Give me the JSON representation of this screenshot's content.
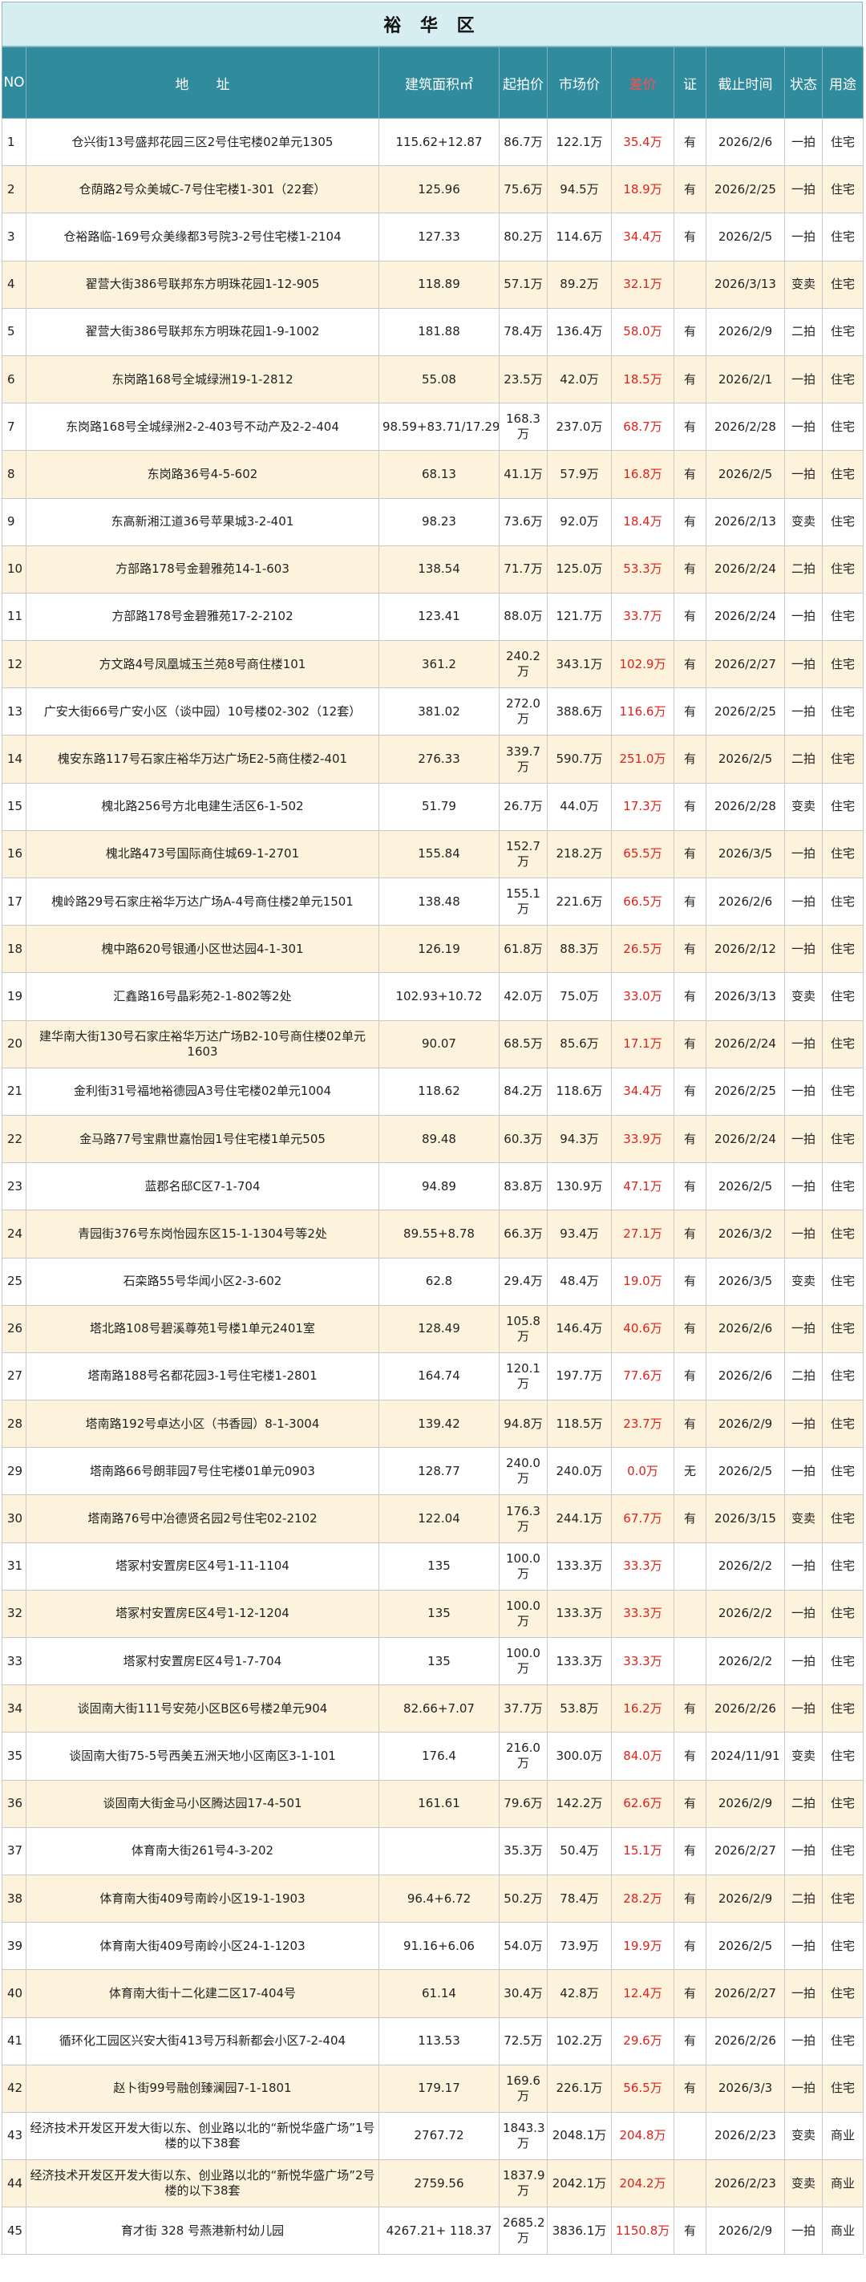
{
  "title": "裕 华 区",
  "headers": [
    "NO",
    "地　　址",
    "建筑面积㎡",
    "起拍价",
    "市场价",
    "差价",
    "证",
    "截止时间",
    "状态",
    "用途"
  ],
  "rows": [
    [
      "1",
      "仓兴街13号盛邦花园三区2号住宅楼02单元1305",
      "115.62+12.87",
      "86.7万",
      "122.1万",
      "35.4万",
      "有",
      "2026/2/6",
      "一拍",
      "住宅"
    ],
    [
      "2",
      "仓荫路2号众美城C-7号住宅楼1-301（22套）",
      "125.96",
      "75.6万",
      "94.5万",
      "18.9万",
      "有",
      "2026/2/25",
      "一拍",
      "住宅"
    ],
    [
      "3",
      "仓裕路临-169号众美缘都3号院3-2号住宅楼1-2104",
      "127.33",
      "80.2万",
      "114.6万",
      "34.4万",
      "有",
      "2026/2/5",
      "一拍",
      "住宅"
    ],
    [
      "4",
      "翟营大街386号联邦东方明珠花园1-12-905",
      "118.89",
      "57.1万",
      "89.2万",
      "32.1万",
      "",
      "2026/3/13",
      "变卖",
      "住宅"
    ],
    [
      "5",
      "翟营大街386号联邦东方明珠花园1-9-1002",
      "181.88",
      "78.4万",
      "136.4万",
      "58.0万",
      "有",
      "2026/2/9",
      "二拍",
      "住宅"
    ],
    [
      "6",
      "东岗路168号全城绿洲19-1-2812",
      "55.08",
      "23.5万",
      "42.0万",
      "18.5万",
      "有",
      "2026/2/1",
      "一拍",
      "住宅"
    ],
    [
      "7",
      "东岗路168号全城绿洲2-2-403号不动产及2-2-404",
      "98.59+83.71/17.29",
      "168.3万",
      "237.0万",
      "68.7万",
      "有",
      "2026/2/28",
      "一拍",
      "住宅"
    ],
    [
      "8",
      "东岗路36号4-5-602",
      "68.13",
      "41.1万",
      "57.9万",
      "16.8万",
      "有",
      "2026/2/5",
      "一拍",
      "住宅"
    ],
    [
      "9",
      "东高新湘江道36号苹果城3-2-401",
      "98.23",
      "73.6万",
      "92.0万",
      "18.4万",
      "有",
      "2026/2/13",
      "变卖",
      "住宅"
    ],
    [
      "10",
      "方部路178号金碧雅苑14-1-603",
      "138.54",
      "71.7万",
      "125.0万",
      "53.3万",
      "有",
      "2026/2/24",
      "二拍",
      "住宅"
    ],
    [
      "11",
      "方部路178号金碧雅苑17-2-2102",
      "123.41",
      "88.0万",
      "121.7万",
      "33.7万",
      "有",
      "2026/2/24",
      "一拍",
      "住宅"
    ],
    [
      "12",
      "方文路4号凤凰城玉兰苑8号商住楼101",
      "361.2",
      "240.2万",
      "343.1万",
      "102.9万",
      "有",
      "2026/2/27",
      "一拍",
      "住宅"
    ],
    [
      "13",
      "广安大街66号广安小区（谈中园）10号楼02-302（12套）",
      "381.02",
      "272.0万",
      "388.6万",
      "116.6万",
      "有",
      "2026/2/25",
      "一拍",
      "住宅"
    ],
    [
      "14",
      "槐安东路117号石家庄裕华万达广场E2-5商住楼2-401",
      "276.33",
      "339.7万",
      "590.7万",
      "251.0万",
      "有",
      "2026/2/5",
      "二拍",
      "住宅"
    ],
    [
      "15",
      "槐北路256号方北电建生活区6-1-502",
      "51.79",
      "26.7万",
      "44.0万",
      "17.3万",
      "有",
      "2026/2/28",
      "变卖",
      "住宅"
    ],
    [
      "16",
      "槐北路473号国际商住城69-1-2701",
      "155.84",
      "152.7万",
      "218.2万",
      "65.5万",
      "有",
      "2026/3/5",
      "一拍",
      "住宅"
    ],
    [
      "17",
      "槐岭路29号石家庄裕华万达广场A-4号商住楼2单元1501",
      "138.48",
      "155.1万",
      "221.6万",
      "66.5万",
      "有",
      "2026/2/6",
      "一拍",
      "住宅"
    ],
    [
      "18",
      "槐中路620号银通小区世达园4-1-301",
      "126.19",
      "61.8万",
      "88.3万",
      "26.5万",
      "有",
      "2026/2/12",
      "一拍",
      "住宅"
    ],
    [
      "19",
      "汇鑫路16号晶彩苑2-1-802等2处",
      "102.93+10.72",
      "42.0万",
      "75.0万",
      "33.0万",
      "有",
      "2026/3/13",
      "变卖",
      "住宅"
    ],
    [
      "20",
      "建华南大街130号石家庄裕华万达广场B2-10号商住楼02单元1603",
      "90.07",
      "68.5万",
      "85.6万",
      "17.1万",
      "有",
      "2026/2/24",
      "一拍",
      "住宅"
    ],
    [
      "21",
      "金利街31号福地裕德园A3号住宅楼02单元1004",
      "118.62",
      "84.2万",
      "118.6万",
      "34.4万",
      "有",
      "2026/2/25",
      "一拍",
      "住宅"
    ],
    [
      "22",
      "金马路77号宝鼎世嘉怡园1号住宅楼1单元505",
      "89.48",
      "60.3万",
      "94.3万",
      "33.9万",
      "有",
      "2026/2/24",
      "一拍",
      "住宅"
    ],
    [
      "23",
      "蓝郡名邸C区7-1-704",
      "94.89",
      "83.8万",
      "130.9万",
      "47.1万",
      "有",
      "2026/2/5",
      "一拍",
      "住宅"
    ],
    [
      "24",
      "青园街376号东岗怡园东区15-1-1304号等2处",
      "89.55+8.78",
      "66.3万",
      "93.4万",
      "27.1万",
      "有",
      "2026/3/2",
      "一拍",
      "住宅"
    ],
    [
      "25",
      "石栾路55号华闻小区2-3-602",
      "62.8",
      "29.4万",
      "48.4万",
      "19.0万",
      "有",
      "2026/3/5",
      "变卖",
      "住宅"
    ],
    [
      "26",
      "塔北路108号碧溪尊苑1号楼1单元2401室",
      "128.49",
      "105.8万",
      "146.4万",
      "40.6万",
      "有",
      "2026/2/6",
      "一拍",
      "住宅"
    ],
    [
      "27",
      "塔南路188号名都花园3-1号住宅楼1-2801",
      "164.74",
      "120.1万",
      "197.7万",
      "77.6万",
      "有",
      "2026/2/6",
      "二拍",
      "住宅"
    ],
    [
      "28",
      "塔南路192号卓达小区（书香园）8-1-3004",
      "139.42",
      "94.8万",
      "118.5万",
      "23.7万",
      "有",
      "2026/2/9",
      "一拍",
      "住宅"
    ],
    [
      "29",
      "塔南路66号朗菲园7号住宅楼01单元0903",
      "128.77",
      "240.0万",
      "240.0万",
      "0.0万",
      "无",
      "2026/2/5",
      "一拍",
      "住宅"
    ],
    [
      "30",
      "塔南路76号中冶德贤名园2号住宅02-2102",
      "122.04",
      "176.3万",
      "244.1万",
      "67.7万",
      "有",
      "2026/3/15",
      "变卖",
      "住宅"
    ],
    [
      "31",
      "塔冢村安置房E区4号1-11-1104",
      "135",
      "100.0万",
      "133.3万",
      "33.3万",
      "",
      "2026/2/2",
      "一拍",
      "住宅"
    ],
    [
      "32",
      "塔冢村安置房E区4号1-12-1204",
      "135",
      "100.0万",
      "133.3万",
      "33.3万",
      "",
      "2026/2/2",
      "一拍",
      "住宅"
    ],
    [
      "33",
      "塔冢村安置房E区4号1-7-704",
      "135",
      "100.0万",
      "133.3万",
      "33.3万",
      "",
      "2026/2/2",
      "一拍",
      "住宅"
    ],
    [
      "34",
      "谈固南大街111号安苑小区B区6号楼2单元904",
      "82.66+7.07",
      "37.7万",
      "53.8万",
      "16.2万",
      "有",
      "2026/2/26",
      "一拍",
      "住宅"
    ],
    [
      "35",
      "谈固南大街75-5号西美五洲天地小区南区3-1-101",
      "176.4",
      "216.0万",
      "300.0万",
      "84.0万",
      "有",
      "2024/11/91",
      "变卖",
      "住宅"
    ],
    [
      "36",
      "谈固南大街金马小区腾达园17-4-501",
      "161.61",
      "79.6万",
      "142.2万",
      "62.6万",
      "有",
      "2026/2/9",
      "二拍",
      "住宅"
    ],
    [
      "37",
      "体育南大街261号4-3-202",
      "",
      "35.3万",
      "50.4万",
      "15.1万",
      "有",
      "2026/2/27",
      "一拍",
      "住宅"
    ],
    [
      "38",
      "体育南大街409号南岭小区19-1-1903",
      "96.4+6.72",
      "50.2万",
      "78.4万",
      "28.2万",
      "有",
      "2026/2/9",
      "二拍",
      "住宅"
    ],
    [
      "39",
      "体育南大街409号南岭小区24-1-1203",
      "91.16+6.06",
      "54.0万",
      "73.9万",
      "19.9万",
      "有",
      "2026/2/5",
      "一拍",
      "住宅"
    ],
    [
      "40",
      "体育南大街十二化建二区17-404号",
      "61.14",
      "30.4万",
      "42.8万",
      "12.4万",
      "有",
      "2026/2/27",
      "一拍",
      "住宅"
    ],
    [
      "41",
      "循环化工园区兴安大街413号万科新都会小区7-2-404",
      "113.53",
      "72.5万",
      "102.2万",
      "29.6万",
      "有",
      "2026/2/26",
      "一拍",
      "住宅"
    ],
    [
      "42",
      "赵卜街99号融创臻澜园7-1-1801",
      "179.17",
      "169.6万",
      "226.1万",
      "56.5万",
      "有",
      "2026/3/3",
      "一拍",
      "住宅"
    ],
    [
      "43",
      "经济技术开发区开发大街以东、创业路以北的“新悦华盛广场”1号楼的以下38套",
      "2767.72",
      "1843.3万",
      "2048.1万",
      "204.8万",
      "",
      "2026/2/23",
      "变卖",
      "商业"
    ],
    [
      "44",
      "经济技术开发区开发大街以东、创业路以北的“新悦华盛广场”2号楼的以下38套",
      "2759.56",
      "1837.9万",
      "2042.1万",
      "204.2万",
      "",
      "2026/2/23",
      "变卖",
      "商业"
    ],
    [
      "45",
      "育才街 328 号燕港新村幼儿园",
      "4267.21+ 118.37",
      "2685.2万",
      "3836.1万",
      "1150.8万",
      "有",
      "2026/2/9",
      "一拍",
      "商业"
    ]
  ]
}
